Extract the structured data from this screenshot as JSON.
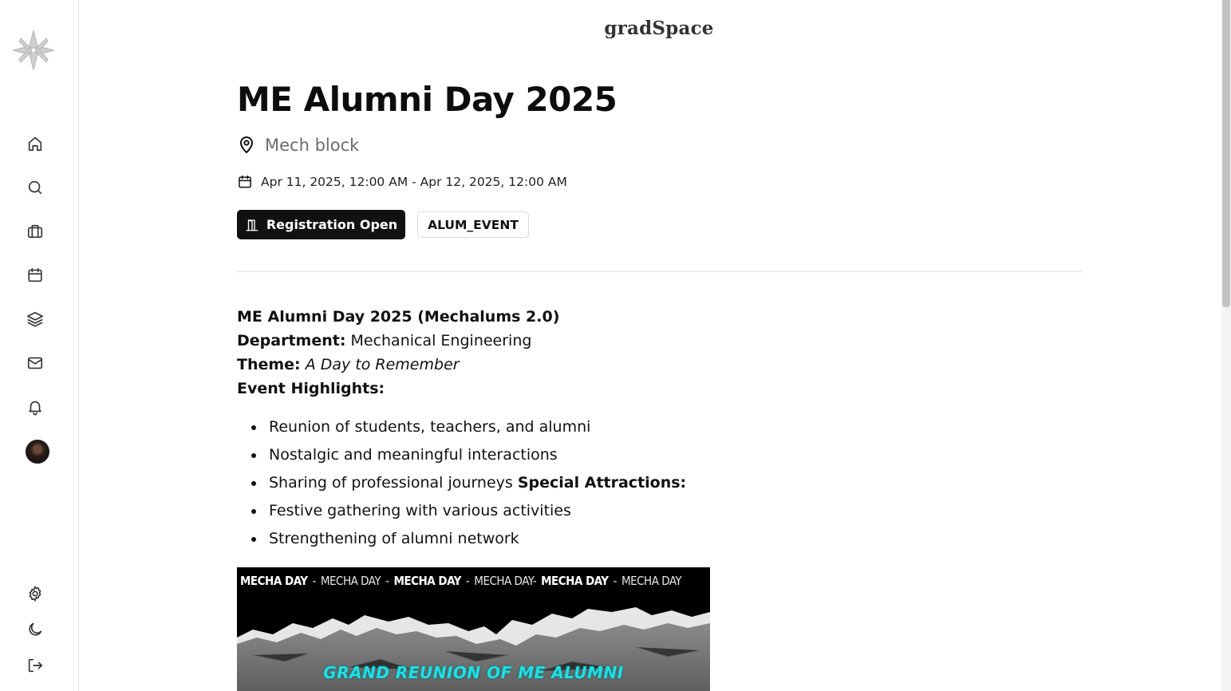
{
  "app": {
    "brand": "gradSpace"
  },
  "sidebar": {
    "nav": [
      {
        "name": "home",
        "icon": "home-icon"
      },
      {
        "name": "search",
        "icon": "search-icon"
      },
      {
        "name": "jobs",
        "icon": "briefcase-icon"
      },
      {
        "name": "events",
        "icon": "calendar-icon"
      },
      {
        "name": "resources",
        "icon": "layers-icon"
      },
      {
        "name": "messages",
        "icon": "mail-icon"
      },
      {
        "name": "notifications",
        "icon": "bell-icon"
      }
    ],
    "bottom": [
      {
        "name": "settings",
        "icon": "gear-icon"
      },
      {
        "name": "theme",
        "icon": "moon-icon"
      },
      {
        "name": "logout",
        "icon": "logout-icon"
      }
    ]
  },
  "event": {
    "title": "ME Alumni Day 2025",
    "location": "Mech block",
    "date_range": "Apr 11, 2025, 12:00 AM - Apr 12, 2025, 12:00 AM",
    "status_badge": "Registration Open",
    "type_badge": "ALUM_EVENT"
  },
  "description": {
    "heading": "ME Alumni Day 2025 (Mechalums 2.0)",
    "department_label": "Department:",
    "department_value": "Mechanical Engineering",
    "theme_label": "Theme:",
    "theme_value": "A Day to Remember",
    "highlights_label": "Event Highlights:",
    "highlights": [
      "Reunion of students, teachers, and alumni",
      "Nostalgic and meaningful interactions",
      "Sharing of professional journeys",
      "Festive gathering with various activities",
      "Strengthening of alumni network"
    ],
    "special_label": "Special Attractions:"
  },
  "poster": {
    "ticker": [
      {
        "text": "MECHA DAY",
        "bold": true
      },
      {
        "text": "-",
        "bold": false
      },
      {
        "text": "MECHA DAY",
        "bold": false
      },
      {
        "text": "-",
        "bold": false
      },
      {
        "text": "MECHA DAY",
        "bold": true
      },
      {
        "text": "-",
        "bold": false
      },
      {
        "text": "MECHA DAY-",
        "bold": false
      },
      {
        "text": "MECHA DAY",
        "bold": true
      },
      {
        "text": "-",
        "bold": false
      },
      {
        "text": "MECHA DAY",
        "bold": false
      }
    ],
    "caption": "GRAND REUNION OF ME ALUMNI"
  },
  "colors": {
    "accent": "#111111",
    "caption": "#1fe0e6"
  }
}
